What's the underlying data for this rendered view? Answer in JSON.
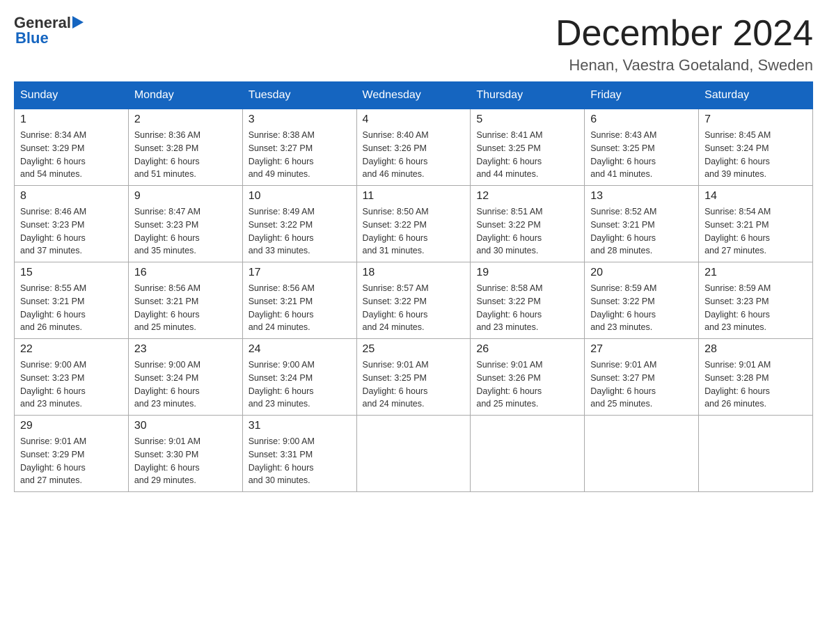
{
  "header": {
    "month_title": "December 2024",
    "location": "Henan, Vaestra Goetaland, Sweden",
    "logo_general": "General",
    "logo_blue": "Blue"
  },
  "columns": [
    "Sunday",
    "Monday",
    "Tuesday",
    "Wednesday",
    "Thursday",
    "Friday",
    "Saturday"
  ],
  "weeks": [
    [
      {
        "day": "1",
        "sunrise": "Sunrise: 8:34 AM",
        "sunset": "Sunset: 3:29 PM",
        "daylight": "Daylight: 6 hours",
        "daylight2": "and 54 minutes."
      },
      {
        "day": "2",
        "sunrise": "Sunrise: 8:36 AM",
        "sunset": "Sunset: 3:28 PM",
        "daylight": "Daylight: 6 hours",
        "daylight2": "and 51 minutes."
      },
      {
        "day": "3",
        "sunrise": "Sunrise: 8:38 AM",
        "sunset": "Sunset: 3:27 PM",
        "daylight": "Daylight: 6 hours",
        "daylight2": "and 49 minutes."
      },
      {
        "day": "4",
        "sunrise": "Sunrise: 8:40 AM",
        "sunset": "Sunset: 3:26 PM",
        "daylight": "Daylight: 6 hours",
        "daylight2": "and 46 minutes."
      },
      {
        "day": "5",
        "sunrise": "Sunrise: 8:41 AM",
        "sunset": "Sunset: 3:25 PM",
        "daylight": "Daylight: 6 hours",
        "daylight2": "and 44 minutes."
      },
      {
        "day": "6",
        "sunrise": "Sunrise: 8:43 AM",
        "sunset": "Sunset: 3:25 PM",
        "daylight": "Daylight: 6 hours",
        "daylight2": "and 41 minutes."
      },
      {
        "day": "7",
        "sunrise": "Sunrise: 8:45 AM",
        "sunset": "Sunset: 3:24 PM",
        "daylight": "Daylight: 6 hours",
        "daylight2": "and 39 minutes."
      }
    ],
    [
      {
        "day": "8",
        "sunrise": "Sunrise: 8:46 AM",
        "sunset": "Sunset: 3:23 PM",
        "daylight": "Daylight: 6 hours",
        "daylight2": "and 37 minutes."
      },
      {
        "day": "9",
        "sunrise": "Sunrise: 8:47 AM",
        "sunset": "Sunset: 3:23 PM",
        "daylight": "Daylight: 6 hours",
        "daylight2": "and 35 minutes."
      },
      {
        "day": "10",
        "sunrise": "Sunrise: 8:49 AM",
        "sunset": "Sunset: 3:22 PM",
        "daylight": "Daylight: 6 hours",
        "daylight2": "and 33 minutes."
      },
      {
        "day": "11",
        "sunrise": "Sunrise: 8:50 AM",
        "sunset": "Sunset: 3:22 PM",
        "daylight": "Daylight: 6 hours",
        "daylight2": "and 31 minutes."
      },
      {
        "day": "12",
        "sunrise": "Sunrise: 8:51 AM",
        "sunset": "Sunset: 3:22 PM",
        "daylight": "Daylight: 6 hours",
        "daylight2": "and 30 minutes."
      },
      {
        "day": "13",
        "sunrise": "Sunrise: 8:52 AM",
        "sunset": "Sunset: 3:21 PM",
        "daylight": "Daylight: 6 hours",
        "daylight2": "and 28 minutes."
      },
      {
        "day": "14",
        "sunrise": "Sunrise: 8:54 AM",
        "sunset": "Sunset: 3:21 PM",
        "daylight": "Daylight: 6 hours",
        "daylight2": "and 27 minutes."
      }
    ],
    [
      {
        "day": "15",
        "sunrise": "Sunrise: 8:55 AM",
        "sunset": "Sunset: 3:21 PM",
        "daylight": "Daylight: 6 hours",
        "daylight2": "and 26 minutes."
      },
      {
        "day": "16",
        "sunrise": "Sunrise: 8:56 AM",
        "sunset": "Sunset: 3:21 PM",
        "daylight": "Daylight: 6 hours",
        "daylight2": "and 25 minutes."
      },
      {
        "day": "17",
        "sunrise": "Sunrise: 8:56 AM",
        "sunset": "Sunset: 3:21 PM",
        "daylight": "Daylight: 6 hours",
        "daylight2": "and 24 minutes."
      },
      {
        "day": "18",
        "sunrise": "Sunrise: 8:57 AM",
        "sunset": "Sunset: 3:22 PM",
        "daylight": "Daylight: 6 hours",
        "daylight2": "and 24 minutes."
      },
      {
        "day": "19",
        "sunrise": "Sunrise: 8:58 AM",
        "sunset": "Sunset: 3:22 PM",
        "daylight": "Daylight: 6 hours",
        "daylight2": "and 23 minutes."
      },
      {
        "day": "20",
        "sunrise": "Sunrise: 8:59 AM",
        "sunset": "Sunset: 3:22 PM",
        "daylight": "Daylight: 6 hours",
        "daylight2": "and 23 minutes."
      },
      {
        "day": "21",
        "sunrise": "Sunrise: 8:59 AM",
        "sunset": "Sunset: 3:23 PM",
        "daylight": "Daylight: 6 hours",
        "daylight2": "and 23 minutes."
      }
    ],
    [
      {
        "day": "22",
        "sunrise": "Sunrise: 9:00 AM",
        "sunset": "Sunset: 3:23 PM",
        "daylight": "Daylight: 6 hours",
        "daylight2": "and 23 minutes."
      },
      {
        "day": "23",
        "sunrise": "Sunrise: 9:00 AM",
        "sunset": "Sunset: 3:24 PM",
        "daylight": "Daylight: 6 hours",
        "daylight2": "and 23 minutes."
      },
      {
        "day": "24",
        "sunrise": "Sunrise: 9:00 AM",
        "sunset": "Sunset: 3:24 PM",
        "daylight": "Daylight: 6 hours",
        "daylight2": "and 23 minutes."
      },
      {
        "day": "25",
        "sunrise": "Sunrise: 9:01 AM",
        "sunset": "Sunset: 3:25 PM",
        "daylight": "Daylight: 6 hours",
        "daylight2": "and 24 minutes."
      },
      {
        "day": "26",
        "sunrise": "Sunrise: 9:01 AM",
        "sunset": "Sunset: 3:26 PM",
        "daylight": "Daylight: 6 hours",
        "daylight2": "and 25 minutes."
      },
      {
        "day": "27",
        "sunrise": "Sunrise: 9:01 AM",
        "sunset": "Sunset: 3:27 PM",
        "daylight": "Daylight: 6 hours",
        "daylight2": "and 25 minutes."
      },
      {
        "day": "28",
        "sunrise": "Sunrise: 9:01 AM",
        "sunset": "Sunset: 3:28 PM",
        "daylight": "Daylight: 6 hours",
        "daylight2": "and 26 minutes."
      }
    ],
    [
      {
        "day": "29",
        "sunrise": "Sunrise: 9:01 AM",
        "sunset": "Sunset: 3:29 PM",
        "daylight": "Daylight: 6 hours",
        "daylight2": "and 27 minutes."
      },
      {
        "day": "30",
        "sunrise": "Sunrise: 9:01 AM",
        "sunset": "Sunset: 3:30 PM",
        "daylight": "Daylight: 6 hours",
        "daylight2": "and 29 minutes."
      },
      {
        "day": "31",
        "sunrise": "Sunrise: 9:00 AM",
        "sunset": "Sunset: 3:31 PM",
        "daylight": "Daylight: 6 hours",
        "daylight2": "and 30 minutes."
      },
      null,
      null,
      null,
      null
    ]
  ]
}
